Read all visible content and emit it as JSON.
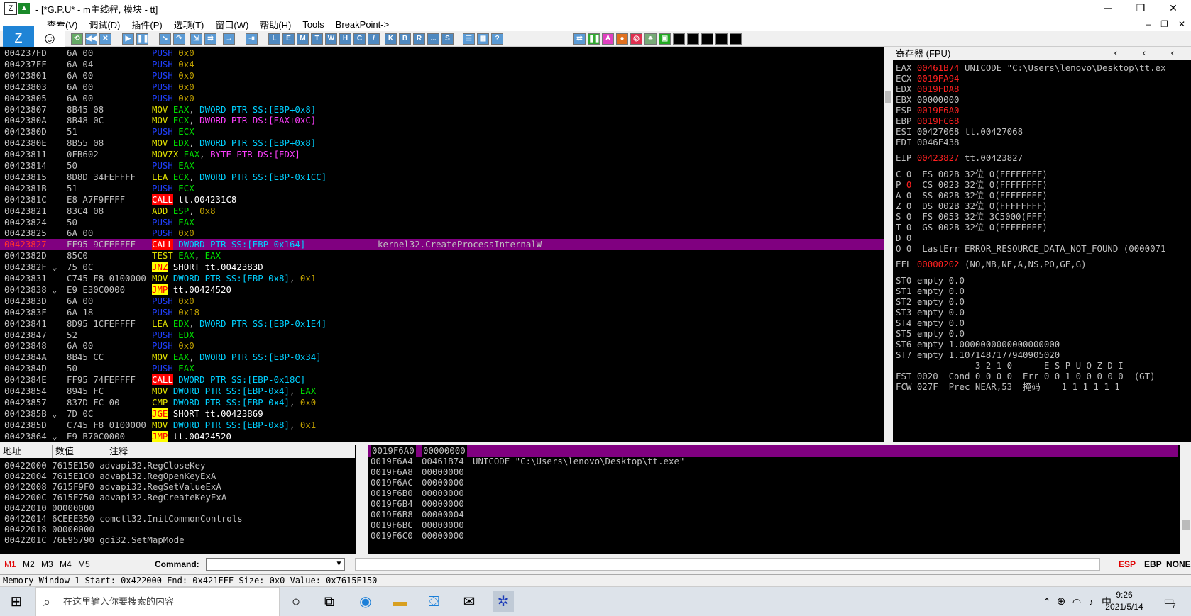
{
  "window": {
    "icon_label": "Z",
    "title": "- [*G.P.U* - m主线程, 模块 - tt]",
    "minimize": "─",
    "maximize": "❐",
    "close": "✕"
  },
  "menu": [
    "查看(V)",
    "调试(D)",
    "插件(P)",
    "选项(T)",
    "窗口(W)",
    "帮助(H)",
    "Tools",
    "BreakPoint->"
  ],
  "mdi": {
    "min": "–",
    "restore": "❐",
    "close": "✕"
  },
  "overlay": {
    "z_label": "Z",
    "smile": "☺"
  },
  "toolbar": {
    "letters": [
      "L",
      "E",
      "M",
      "T",
      "W",
      "H",
      "C",
      "/",
      "K",
      "B",
      "R",
      "...",
      "S"
    ]
  },
  "cpu": {
    "rows": [
      {
        "addr": "004237FD",
        "hex": "6A 00",
        "parts": [
          {
            "t": "PUSH",
            "c": "#2040ff"
          },
          {
            "t": " 0x0",
            "c": "#c0a000"
          }
        ],
        "comment": ""
      },
      {
        "addr": "004237FF",
        "hex": "6A 04",
        "parts": [
          {
            "t": "PUSH",
            "c": "#2040ff"
          },
          {
            "t": " 0x4",
            "c": "#c0a000"
          }
        ],
        "comment": ""
      },
      {
        "addr": "00423801",
        "hex": "6A 00",
        "parts": [
          {
            "t": "PUSH",
            "c": "#2040ff"
          },
          {
            "t": " 0x0",
            "c": "#c0a000"
          }
        ],
        "comment": ""
      },
      {
        "addr": "00423803",
        "hex": "6A 00",
        "parts": [
          {
            "t": "PUSH",
            "c": "#2040ff"
          },
          {
            "t": " 0x0",
            "c": "#c0a000"
          }
        ],
        "comment": ""
      },
      {
        "addr": "00423805",
        "hex": "6A 00",
        "parts": [
          {
            "t": "PUSH",
            "c": "#2040ff"
          },
          {
            "t": " 0x0",
            "c": "#c0a000"
          }
        ],
        "comment": ""
      },
      {
        "addr": "00423807",
        "hex": "8B45 08",
        "parts": [
          {
            "t": "MOV",
            "c": "#e0e000"
          },
          {
            "t": " EAX",
            "c": "#00e000"
          },
          {
            "t": ", ",
            "c": "#c0c0c0"
          },
          {
            "t": "DWORD PTR SS:[EBP+0x8]",
            "c": "#00d0ff"
          }
        ],
        "comment": ""
      },
      {
        "addr": "0042380A",
        "hex": "8B48 0C",
        "parts": [
          {
            "t": "MOV",
            "c": "#e0e000"
          },
          {
            "t": " ECX",
            "c": "#00e000"
          },
          {
            "t": ", ",
            "c": "#c0c0c0"
          },
          {
            "t": "DWORD PTR DS:[EAX+0xC]",
            "c": "#ff40ff"
          }
        ],
        "comment": ""
      },
      {
        "addr": "0042380D",
        "hex": "51",
        "parts": [
          {
            "t": "PUSH",
            "c": "#2040ff"
          },
          {
            "t": " ECX",
            "c": "#00e000"
          }
        ],
        "comment": ""
      },
      {
        "addr": "0042380E",
        "hex": "8B55 08",
        "parts": [
          {
            "t": "MOV",
            "c": "#e0e000"
          },
          {
            "t": " EDX",
            "c": "#00e000"
          },
          {
            "t": ", ",
            "c": "#c0c0c0"
          },
          {
            "t": "DWORD PTR SS:[EBP+0x8]",
            "c": "#00d0ff"
          }
        ],
        "comment": ""
      },
      {
        "addr": "00423811",
        "hex": "0FB602",
        "parts": [
          {
            "t": "MOVZX",
            "c": "#e0e000"
          },
          {
            "t": " EAX",
            "c": "#00e000"
          },
          {
            "t": ", ",
            "c": "#c0c0c0"
          },
          {
            "t": "BYTE PTR DS:[EDX]",
            "c": "#ff40ff"
          }
        ],
        "comment": ""
      },
      {
        "addr": "00423814",
        "hex": "50",
        "parts": [
          {
            "t": "PUSH",
            "c": "#2040ff"
          },
          {
            "t": " EAX",
            "c": "#00e000"
          }
        ],
        "comment": ""
      },
      {
        "addr": "00423815",
        "hex": "8D8D 34FEFFFF",
        "parts": [
          {
            "t": "LEA",
            "c": "#e0e000"
          },
          {
            "t": " ECX",
            "c": "#00e000"
          },
          {
            "t": ", ",
            "c": "#c0c0c0"
          },
          {
            "t": "DWORD PTR SS:[EBP-0x1CC]",
            "c": "#00d0ff"
          }
        ],
        "comment": ""
      },
      {
        "addr": "0042381B",
        "hex": "51",
        "parts": [
          {
            "t": "PUSH",
            "c": "#2040ff"
          },
          {
            "t": " ECX",
            "c": "#00e000"
          }
        ],
        "comment": ""
      },
      {
        "addr": "0042381C",
        "hex": "E8 A7F9FFFF",
        "parts": [
          {
            "t": "CALL",
            "c": "#ffffff",
            "bg": "#ff0000"
          },
          {
            "t": " tt.004231C8",
            "c": "#ffffff"
          }
        ],
        "comment": ""
      },
      {
        "addr": "00423821",
        "hex": "83C4 08",
        "parts": [
          {
            "t": "ADD",
            "c": "#e0e000"
          },
          {
            "t": " ESP",
            "c": "#00e000"
          },
          {
            "t": ", ",
            "c": "#c0c0c0"
          },
          {
            "t": "0x8",
            "c": "#c0a000"
          }
        ],
        "comment": ""
      },
      {
        "addr": "00423824",
        "hex": "50",
        "parts": [
          {
            "t": "PUSH",
            "c": "#2040ff"
          },
          {
            "t": " EAX",
            "c": "#00e000"
          }
        ],
        "comment": ""
      },
      {
        "addr": "00423825",
        "hex": "6A 00",
        "parts": [
          {
            "t": "PUSH",
            "c": "#2040ff"
          },
          {
            "t": " 0x0",
            "c": "#c0a000"
          }
        ],
        "comment": ""
      },
      {
        "addr": "00423827",
        "hex": "FF95 9CFEFFFF",
        "parts": [
          {
            "t": "CALL",
            "c": "#ffffff",
            "bg": "#ff0000"
          },
          {
            "t": " DWORD PTR SS:[EBP-0x164]",
            "c": "#00d0ff"
          }
        ],
        "comment": "kernel32.CreateProcessInternalW",
        "selected": true
      },
      {
        "addr": "0042382D",
        "hex": "85C0",
        "parts": [
          {
            "t": "TEST",
            "c": "#e0e000"
          },
          {
            "t": " EAX",
            "c": "#00e000"
          },
          {
            "t": ", ",
            "c": "#c0c0c0"
          },
          {
            "t": "EAX",
            "c": "#00e000"
          }
        ],
        "comment": ""
      },
      {
        "addr": "0042382F ⌄",
        "hex": "75 0C",
        "parts": [
          {
            "t": "JNZ",
            "c": "#ff0000",
            "bg": "#ffff00"
          },
          {
            "t": " SHORT tt.0042383D",
            "c": "#ffffff"
          }
        ],
        "comment": ""
      },
      {
        "addr": "00423831",
        "hex": "C745 F8 0100000",
        "parts": [
          {
            "t": "MOV",
            "c": "#e0e000"
          },
          {
            "t": " DWORD PTR SS:[EBP-0x8]",
            "c": "#00d0ff"
          },
          {
            "t": ", ",
            "c": "#c0c0c0"
          },
          {
            "t": "0x1",
            "c": "#c0a000"
          }
        ],
        "comment": ""
      },
      {
        "addr": "00423838 ⌄",
        "hex": "E9 E30C0000",
        "parts": [
          {
            "t": "JMP",
            "c": "#ff0000",
            "bg": "#ffff00"
          },
          {
            "t": " tt.00424520",
            "c": "#ffffff"
          }
        ],
        "comment": ""
      },
      {
        "addr": "0042383D",
        "hex": "6A 00",
        "parts": [
          {
            "t": "PUSH",
            "c": "#2040ff"
          },
          {
            "t": " 0x0",
            "c": "#c0a000"
          }
        ],
        "comment": ""
      },
      {
        "addr": "0042383F",
        "hex": "6A 18",
        "parts": [
          {
            "t": "PUSH",
            "c": "#2040ff"
          },
          {
            "t": " 0x18",
            "c": "#c0a000"
          }
        ],
        "comment": ""
      },
      {
        "addr": "00423841",
        "hex": "8D95 1CFEFFFF",
        "parts": [
          {
            "t": "LEA",
            "c": "#e0e000"
          },
          {
            "t": " EDX",
            "c": "#00e000"
          },
          {
            "t": ", ",
            "c": "#c0c0c0"
          },
          {
            "t": "DWORD PTR SS:[EBP-0x1E4]",
            "c": "#00d0ff"
          }
        ],
        "comment": ""
      },
      {
        "addr": "00423847",
        "hex": "52",
        "parts": [
          {
            "t": "PUSH",
            "c": "#2040ff"
          },
          {
            "t": " EDX",
            "c": "#00e000"
          }
        ],
        "comment": ""
      },
      {
        "addr": "00423848",
        "hex": "6A 00",
        "parts": [
          {
            "t": "PUSH",
            "c": "#2040ff"
          },
          {
            "t": " 0x0",
            "c": "#c0a000"
          }
        ],
        "comment": ""
      },
      {
        "addr": "0042384A",
        "hex": "8B45 CC",
        "parts": [
          {
            "t": "MOV",
            "c": "#e0e000"
          },
          {
            "t": " EAX",
            "c": "#00e000"
          },
          {
            "t": ", ",
            "c": "#c0c0c0"
          },
          {
            "t": "DWORD PTR SS:[EBP-0x34]",
            "c": "#00d0ff"
          }
        ],
        "comment": ""
      },
      {
        "addr": "0042384D",
        "hex": "50",
        "parts": [
          {
            "t": "PUSH",
            "c": "#2040ff"
          },
          {
            "t": " EAX",
            "c": "#00e000"
          }
        ],
        "comment": ""
      },
      {
        "addr": "0042384E",
        "hex": "FF95 74FEFFFF",
        "parts": [
          {
            "t": "CALL",
            "c": "#ffffff",
            "bg": "#ff0000"
          },
          {
            "t": " DWORD PTR SS:[EBP-0x18C]",
            "c": "#00d0ff"
          }
        ],
        "comment": ""
      },
      {
        "addr": "00423854",
        "hex": "8945 FC",
        "parts": [
          {
            "t": "MOV",
            "c": "#e0e000"
          },
          {
            "t": " DWORD PTR SS:[EBP-0x4]",
            "c": "#00d0ff"
          },
          {
            "t": ", ",
            "c": "#c0c0c0"
          },
          {
            "t": "EAX",
            "c": "#00e000"
          }
        ],
        "comment": ""
      },
      {
        "addr": "00423857",
        "hex": "837D FC 00",
        "parts": [
          {
            "t": "CMP",
            "c": "#e0e000"
          },
          {
            "t": " DWORD PTR SS:[EBP-0x4]",
            "c": "#00d0ff"
          },
          {
            "t": ", ",
            "c": "#c0c0c0"
          },
          {
            "t": "0x0",
            "c": "#c0a000"
          }
        ],
        "comment": ""
      },
      {
        "addr": "0042385B ⌄",
        "hex": "7D 0C",
        "parts": [
          {
            "t": "JGE",
            "c": "#ff0000",
            "bg": "#ffff00"
          },
          {
            "t": " SHORT tt.00423869",
            "c": "#ffffff"
          }
        ],
        "comment": ""
      },
      {
        "addr": "0042385D",
        "hex": "C745 F8 0100000",
        "parts": [
          {
            "t": "MOV",
            "c": "#e0e000"
          },
          {
            "t": " DWORD PTR SS:[EBP-0x8]",
            "c": "#00d0ff"
          },
          {
            "t": ", ",
            "c": "#c0c0c0"
          },
          {
            "t": "0x1",
            "c": "#c0a000"
          }
        ],
        "comment": ""
      },
      {
        "addr": "00423864 ⌄",
        "hex": "E9 B70C0000",
        "parts": [
          {
            "t": "JMP",
            "c": "#ff0000",
            "bg": "#ffff00"
          },
          {
            "t": " tt.00424520",
            "c": "#ffffff"
          }
        ],
        "comment": ""
      }
    ]
  },
  "registers": {
    "header": "寄存器 (FPU)",
    "nav": [
      "‹",
      "‹",
      "‹"
    ],
    "lines": [
      {
        "name": "EAX",
        "value": "00461B74",
        "value_red": true,
        "comment": "UNICODE \"C:\\Users\\lenovo\\Desktop\\tt.ex"
      },
      {
        "name": "ECX",
        "value": "0019FA94",
        "value_red": true,
        "comment": ""
      },
      {
        "name": "EDX",
        "value": "0019FDA8",
        "value_red": true,
        "comment": ""
      },
      {
        "name": "EBX",
        "value": "00000000",
        "value_red": false,
        "comment": ""
      },
      {
        "name": "ESP",
        "value": "0019F6A0",
        "value_red": true,
        "comment": ""
      },
      {
        "name": "EBP",
        "value": "0019FC68",
        "value_red": true,
        "comment": ""
      },
      {
        "name": "ESI",
        "value": "00427068",
        "value_red": false,
        "comment": "tt.00427068"
      },
      {
        "name": "EDI",
        "value": "0046F438",
        "value_red": false,
        "comment": ""
      }
    ],
    "eip": {
      "name": "EIP",
      "value": "00423827",
      "comment": "tt.00423827"
    },
    "flags": [
      {
        "f": "C 0",
        "seg": "ES 002B 32位 0(FFFFFFFF)",
        "flag_red": false
      },
      {
        "f": "P",
        "fv": "0",
        "seg": "CS 0023 32位 0(FFFFFFFF)",
        "flag_red": true
      },
      {
        "f": "A 0",
        "seg": "SS 002B 32位 0(FFFFFFFF)",
        "flag_red": false
      },
      {
        "f": "Z 0",
        "seg": "DS 002B 32位 0(FFFFFFFF)",
        "flag_red": false
      },
      {
        "f": "S 0",
        "seg": "FS 0053 32位 3C5000(FFF)",
        "flag_red": false
      },
      {
        "f": "T 0",
        "seg": "GS 002B 32位 0(FFFFFFFF)",
        "flag_red": false
      },
      {
        "f": "D 0",
        "seg": "",
        "flag_red": false
      },
      {
        "f": "O 0",
        "seg": "LastErr ERROR_RESOURCE_DATA_NOT_FOUND (0000071",
        "flag_red": false
      }
    ],
    "efl": {
      "name": "EFL",
      "value": "00000202",
      "comment": "(NO,NB,NE,A,NS,PO,GE,G)"
    },
    "fpu": [
      "ST0 empty 0.0",
      "ST1 empty 0.0",
      "ST2 empty 0.0",
      "ST3 empty 0.0",
      "ST4 empty 0.0",
      "ST5 empty 0.0",
      "ST6 empty 1.0000000000000000000",
      "ST7 empty 1.1071487177940905020"
    ],
    "fst_header": "               3 2 1 0      E S P U O Z D I",
    "fst": "FST 0020  Cond 0 0 0 0  Err 0 0 1 0 0 0 0 0  (GT)",
    "fcw": "FCW 027F  Prec NEAR,53  掩码    1 1 1 1 1 1"
  },
  "dump": {
    "headers": [
      "地址",
      "数值",
      "注释"
    ],
    "rows": [
      "00422000 7615E150 advapi32.RegCloseKey",
      "00422004 7615E1C0 advapi32.RegOpenKeyExA",
      "00422008 7615F9F0 advapi32.RegSetValueExA",
      "0042200C 7615E750 advapi32.RegCreateKeyExA",
      "00422010 00000000",
      "00422014 6CEEE350 comctl32.InitCommonControls",
      "00422018 00000000",
      "0042201C 76E95790 gdi32.SetMapMode"
    ]
  },
  "stack": {
    "rows": [
      {
        "addr": "0019F6A0",
        "val": "00000000",
        "comment": "",
        "selected": true
      },
      {
        "addr": "0019F6A4",
        "val": "00461B74",
        "comment": "UNICODE \"C:\\Users\\lenovo\\Desktop\\tt.exe\""
      },
      {
        "addr": "0019F6A8",
        "val": "00000000",
        "comment": ""
      },
      {
        "addr": "0019F6AC",
        "val": "00000000",
        "comment": ""
      },
      {
        "addr": "0019F6B0",
        "val": "00000000",
        "comment": ""
      },
      {
        "addr": "0019F6B4",
        "val": "00000000",
        "comment": ""
      },
      {
        "addr": "0019F6B8",
        "val": "00000004",
        "comment": ""
      },
      {
        "addr": "0019F6BC",
        "val": "00000000",
        "comment": ""
      },
      {
        "addr": "0019F6C0",
        "val": "00000000",
        "comment": ""
      }
    ]
  },
  "cmd": {
    "marks": [
      "M1",
      "M2",
      "M3",
      "M4",
      "M5"
    ],
    "label": "Command:",
    "value": "",
    "regs": [
      "ESP",
      "EBP",
      "NONE"
    ]
  },
  "status": "Memory Window 1  Start: 0x422000  End: 0x421FFF  Size: 0x0 Value: 0x7615E150",
  "taskbar": {
    "search_placeholder": "在这里输入你要搜索的内容",
    "ime": "中",
    "time": "9:26",
    "date": "2021/5/14",
    "notif": "7"
  }
}
